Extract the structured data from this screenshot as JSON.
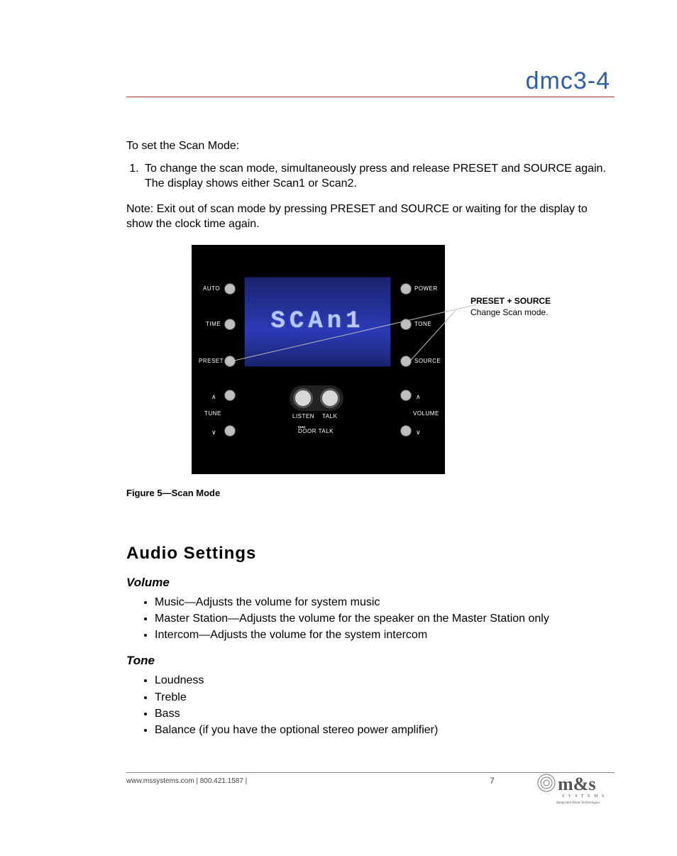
{
  "header": {
    "product": "dmc3-4"
  },
  "intro": "To set the Scan Mode:",
  "step1": "To change the scan mode, simultaneously press and release PRESET and SOURCE again. The display shows either Scan1 or Scan2.",
  "note": "Note: Exit out of scan mode by pressing PRESET and SOURCE or waiting for the display to show the clock time again.",
  "device": {
    "screen_text": "SCAn1",
    "left_labels": {
      "auto": "AUTO",
      "time": "TIME",
      "preset": "PRESET",
      "tune": "TUNE"
    },
    "right_labels": {
      "power": "POWER",
      "tone": "TONE",
      "source": "SOURCE",
      "volume": "VOLUME"
    },
    "center": {
      "listen": "LISTEN",
      "talk": "TALK",
      "door_talk": "DOOR TALK"
    }
  },
  "callout": {
    "title": "PRESET + SOURCE",
    "sub": "Change Scan mode."
  },
  "figure_caption": "Figure 5—Scan Mode",
  "audio_heading": "Audio Settings",
  "volume": {
    "heading": "Volume",
    "items": [
      "Music—Adjusts the volume for system music",
      "Master Station—Adjusts the volume for the speaker on the Master Station only",
      "Intercom—Adjusts the volume for the system intercom"
    ]
  },
  "tone": {
    "heading": "Tone",
    "items": [
      "Loudness",
      "Treble",
      "Bass",
      "Balance (if you have the optional stereo power amplifier)"
    ]
  },
  "footer": {
    "text": "www.mssystems.com | 800.421.1587 |",
    "page": "7",
    "brand": "m&s",
    "brand_sub1": "S Y S T E M S",
    "brand_sub2": "Integrated Home Technologies"
  }
}
